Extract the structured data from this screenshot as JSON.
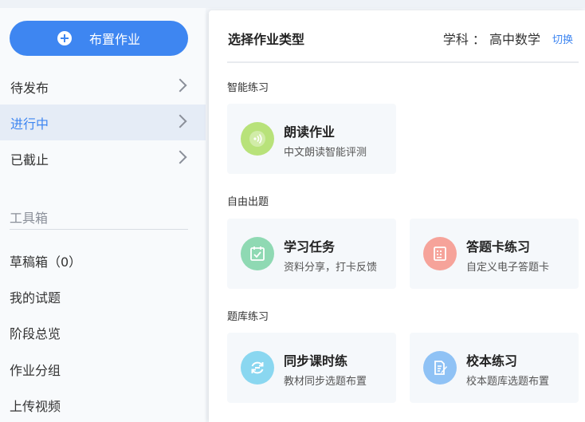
{
  "sidebar": {
    "publish_label": "布置作业",
    "items": [
      {
        "label": "待发布"
      },
      {
        "label": "进行中"
      },
      {
        "label": "已截止"
      }
    ],
    "toolbox_label": "工具箱",
    "tools": [
      {
        "label": "草稿箱（0）"
      },
      {
        "label": "我的试题"
      },
      {
        "label": "阶段总览"
      },
      {
        "label": "作业分组"
      },
      {
        "label": "上传视频"
      }
    ]
  },
  "panel": {
    "title": "选择作业类型",
    "subject_text": "学科 ： 高中数学",
    "switch_label": "切换",
    "sections": [
      {
        "label": "智能练习",
        "cards": [
          {
            "title": "朗读作业",
            "desc": "中文朗读智能评测",
            "icon": "microphone-icon",
            "color": "#b8e27a"
          }
        ]
      },
      {
        "label": "自由出题",
        "cards": [
          {
            "title": "学习任务",
            "desc": "资料分享，打卡反馈",
            "icon": "checkbox-calendar-icon",
            "color": "#8fd9b3"
          },
          {
            "title": "答题卡练习",
            "desc": "自定义电子答题卡",
            "icon": "answer-sheet-icon",
            "color": "#f6a39a"
          }
        ]
      },
      {
        "label": "题库练习",
        "cards": [
          {
            "title": "同步课时练",
            "desc": "教材同步选题布置",
            "icon": "sync-icon",
            "color": "#8ad7f0"
          },
          {
            "title": "校本练习",
            "desc": "校本题库选题布置",
            "icon": "edit-document-icon",
            "color": "#8fc2f5"
          }
        ]
      }
    ]
  }
}
